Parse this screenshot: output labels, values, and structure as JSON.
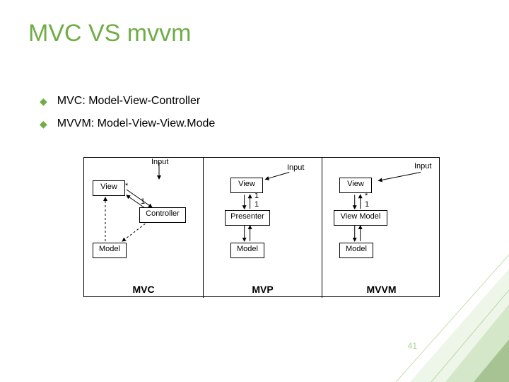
{
  "title": "MVC VS mvvm",
  "bullets": [
    "MVC: Model-View-Controller",
    "MVVM: Model-View-View.Mode"
  ],
  "diagram": {
    "mult_star": "*",
    "mult_one": "1",
    "c1": {
      "name": "MVC",
      "input": "Input",
      "view": "View",
      "controller": "Controller",
      "model": "Model"
    },
    "c2": {
      "name": "MVP",
      "input": "Input",
      "view": "View",
      "presenter": "Presenter",
      "model": "Model"
    },
    "c3": {
      "name": "MVVM",
      "input": "Input",
      "view": "View",
      "viewmodel": "View Model",
      "model": "Model"
    }
  },
  "page_number": "41"
}
